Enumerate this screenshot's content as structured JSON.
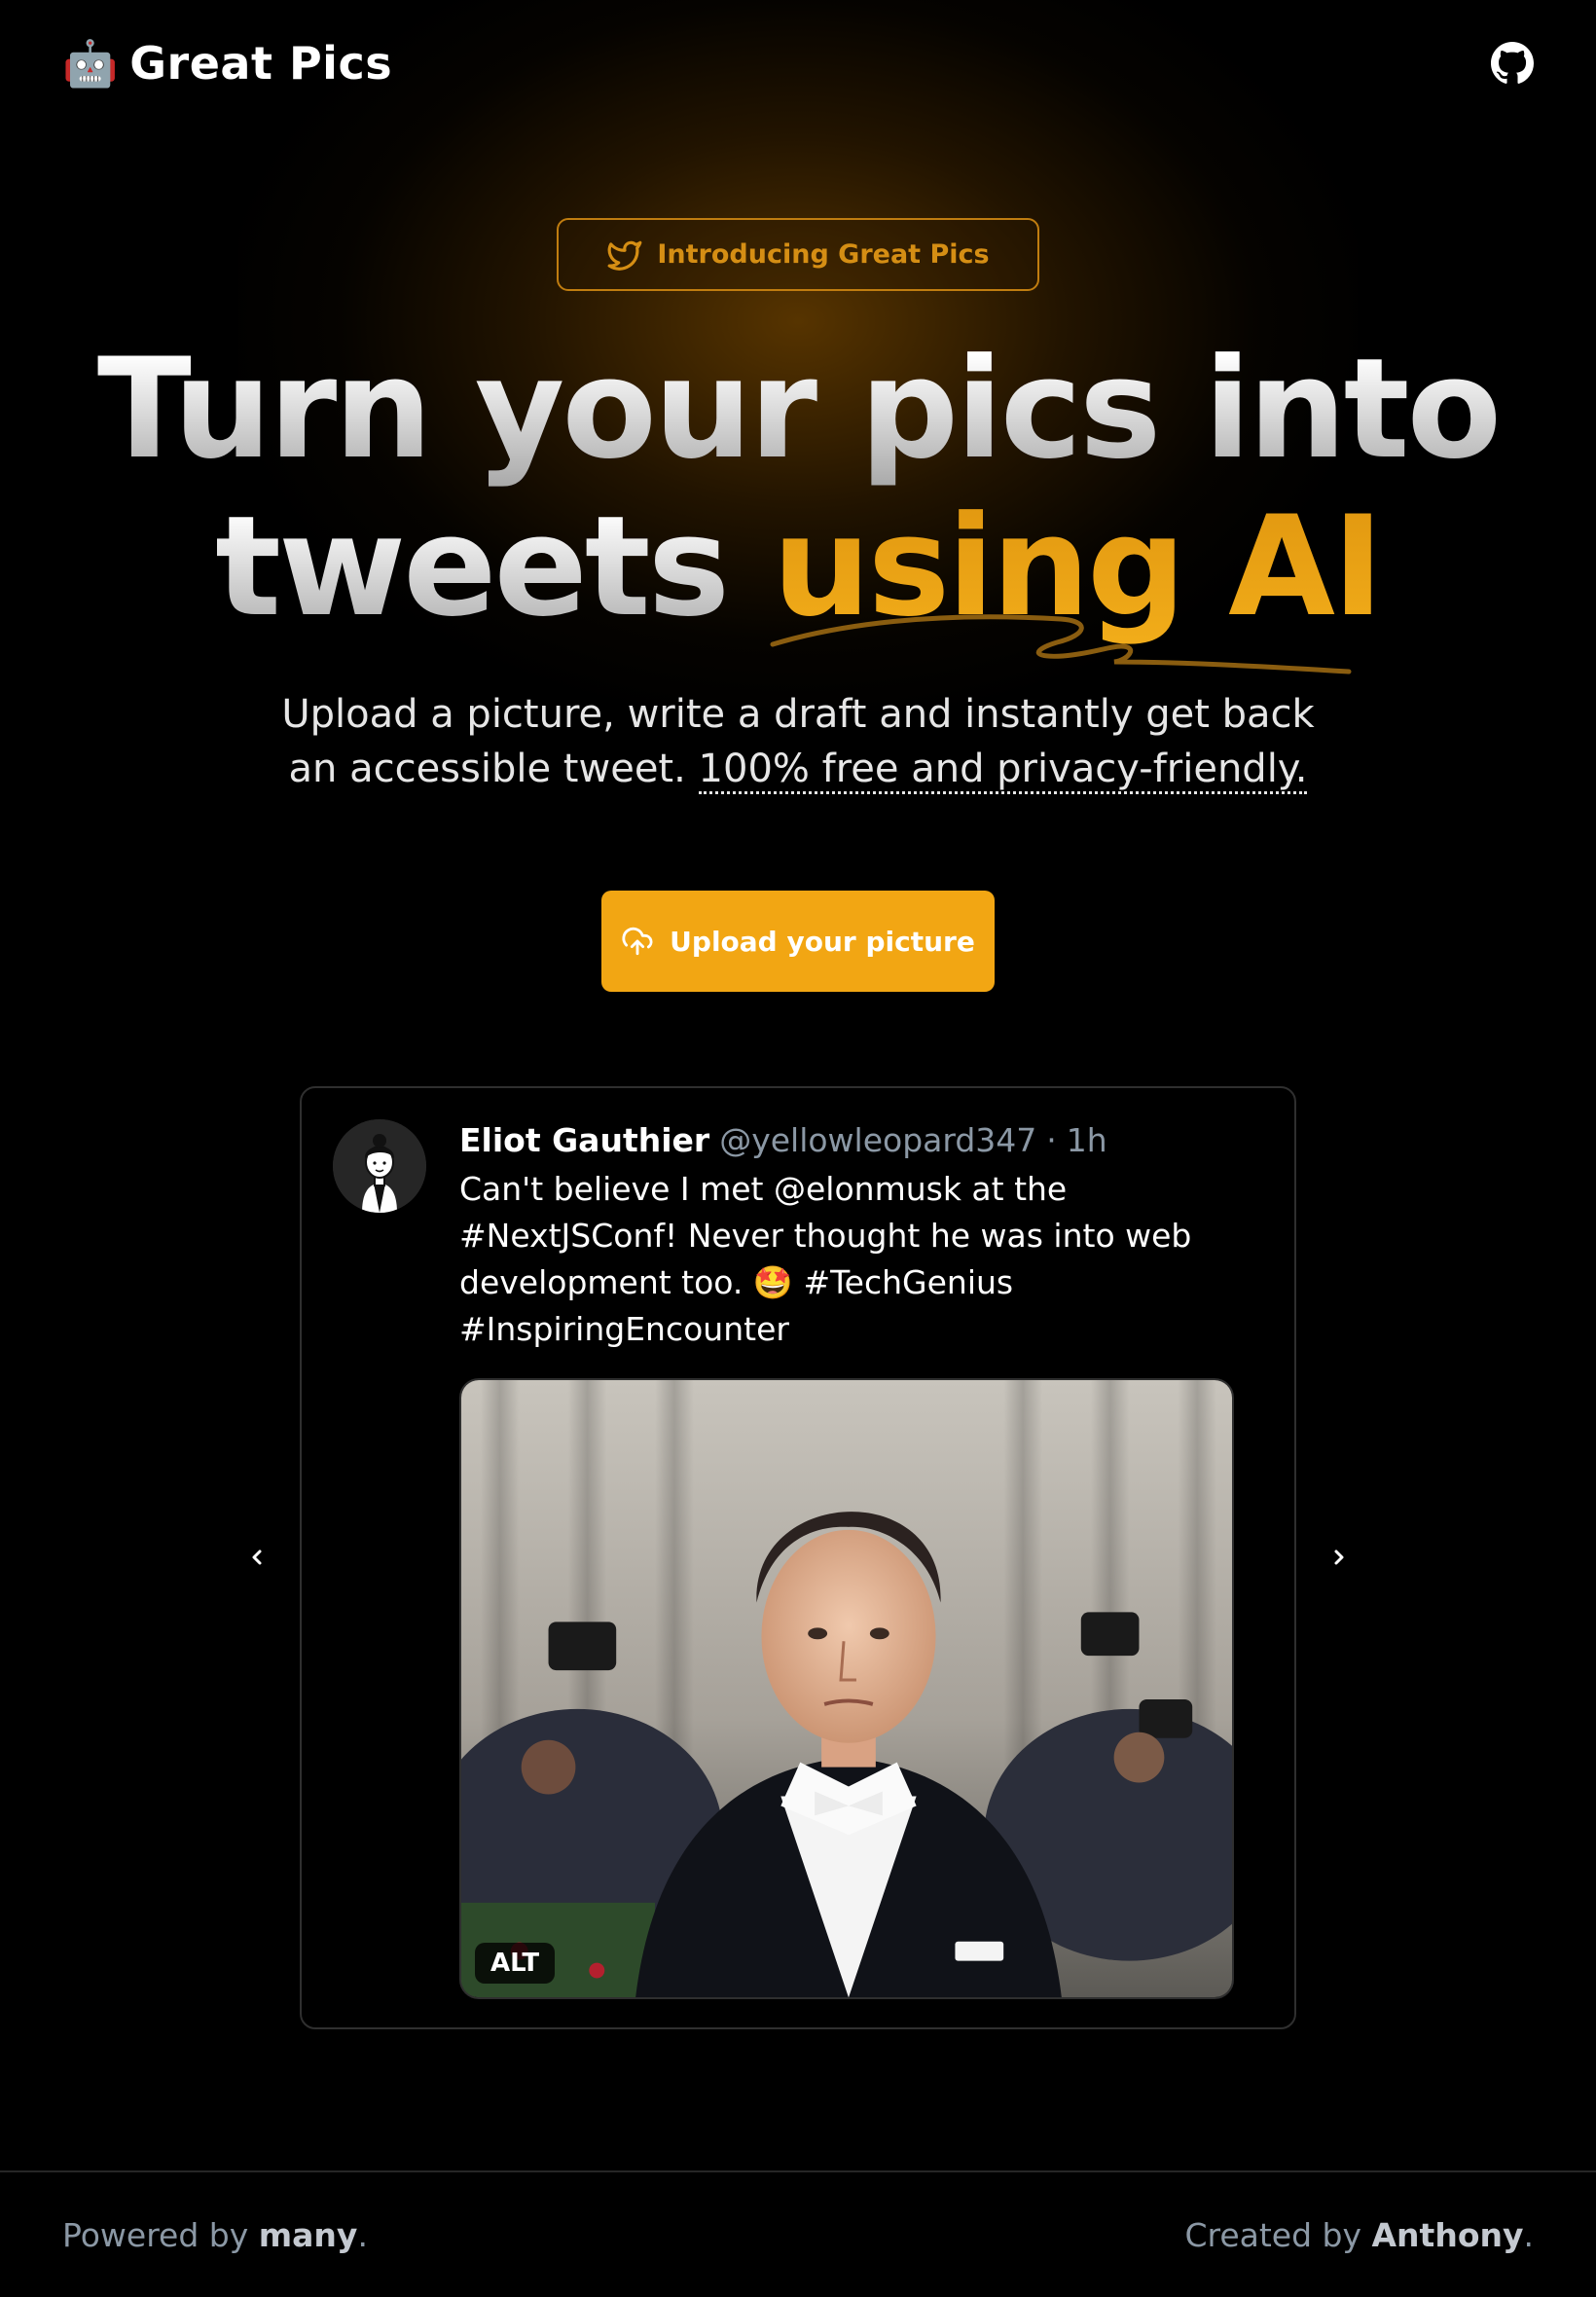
{
  "header": {
    "brand_logo": "🤖",
    "brand_name": "Great Pics",
    "github_icon": "github-icon"
  },
  "hero": {
    "pill_label": "Introducing Great Pics",
    "title_line1": "Turn your pics into",
    "title_line2_plain": "tweets",
    "title_line2_accent": "using AI",
    "subtitle_text": "Upload a picture, write a draft and instantly get back an accessible tweet.",
    "subtitle_link": "100% free and privacy-friendly.",
    "cta_label": "Upload your picture"
  },
  "tweet": {
    "author": "Eliot Gauthier",
    "handle": "@yellowleopard347",
    "separator": "·",
    "time": "1h",
    "text": "Can't believe I met @elonmusk at the #NextJSConf! Never thought he was into web development too. 🤩 #TechGenius #InspiringEncounter",
    "alt_badge": "ALT"
  },
  "footer": {
    "left_prefix": "Powered by",
    "left_link": "many",
    "right_prefix": "Created by",
    "right_link": "Anthony",
    "period": "."
  },
  "colors": {
    "accent": "#f2a613",
    "accent_dark": "#d58e14",
    "background": "#000000",
    "muted": "#8b98a5"
  }
}
